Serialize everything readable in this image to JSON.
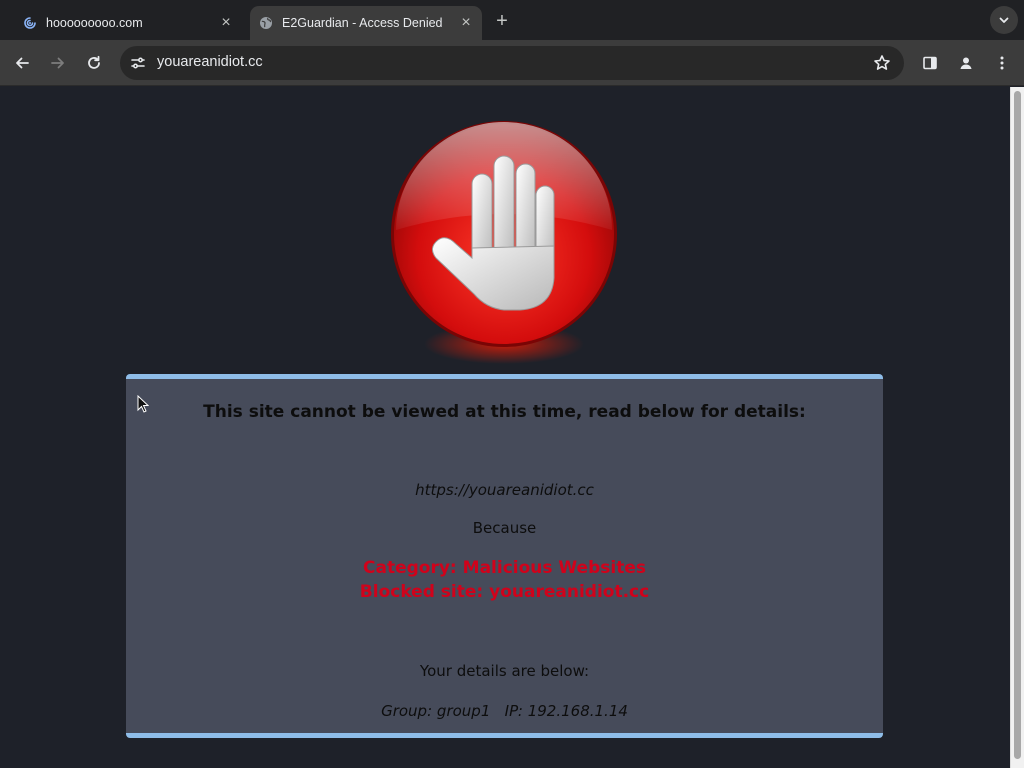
{
  "browser": {
    "tabs": [
      {
        "title": "hooooooooo.com",
        "favicon": "swirl-icon",
        "active": false
      },
      {
        "title": "E2Guardian - Access Denied",
        "favicon": "globe-icon",
        "active": true
      }
    ],
    "address_bar": {
      "url": "youareanidiot.cc"
    }
  },
  "page": {
    "heading": "This site cannot be viewed at this time, read below for details:",
    "blocked_url": "https://youareanidiot.cc",
    "because_label": "Because",
    "reasons": [
      "Category: Malicious Websites",
      "Blocked site: youareanidiot.cc"
    ],
    "details_heading": "Your details are below:",
    "details": {
      "group_label": "Group:",
      "group": "group1",
      "ip_label": "IP:",
      "ip": "192.168.1.14"
    }
  },
  "colors": {
    "background": "#1e2129",
    "card": "#464b5a",
    "card_border": "#8fbde8",
    "reason_text": "#d0021b",
    "stop_red": "#e01010"
  }
}
